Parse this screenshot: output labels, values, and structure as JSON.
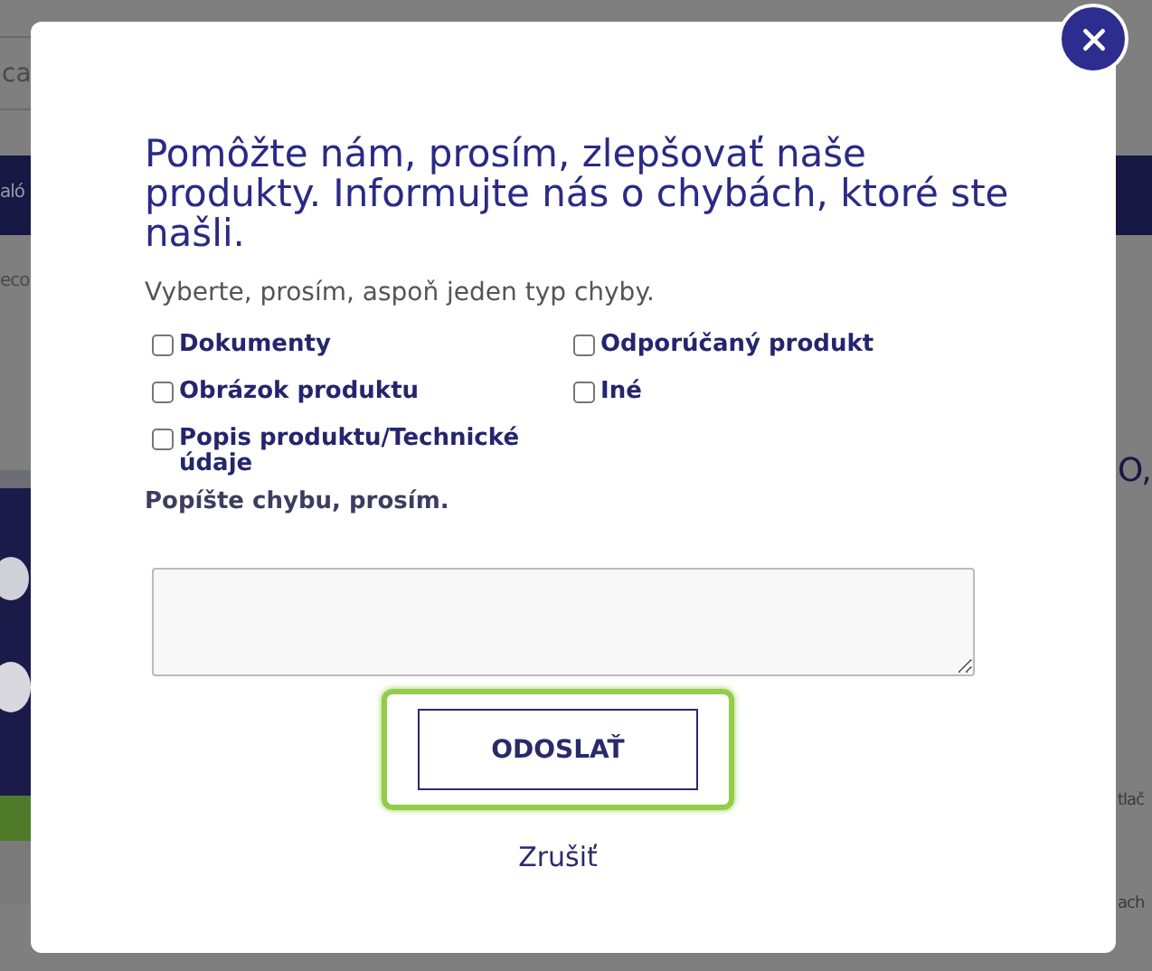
{
  "background": {
    "search_fragment": "ca",
    "nav_fragment": "aló",
    "breadcrumb_fragment": "eco",
    "heading_fragment": "O,",
    "text_fragments": [
      "tlač",
      "ach"
    ]
  },
  "dialog": {
    "title": "Pomôžte nám, prosím, zlepšovať naše produkty. Informujte nás o chybách, ktoré ste našli.",
    "instruction": "Vyberte, prosím, aspoň jeden typ chyby.",
    "options": [
      {
        "label": "Dokumenty",
        "checked": false
      },
      {
        "label": "Odporúčaný produkt",
        "checked": false
      },
      {
        "label": "Obrázok produktu",
        "checked": false
      },
      {
        "label": "Iné",
        "checked": false
      },
      {
        "label": "Popis produktu/Technické údaje",
        "checked": false
      }
    ],
    "description_label": "Popíšte chybu, prosím.",
    "submit": {
      "label": "ODOSLAŤ",
      "focused": true
    },
    "cancel": "Zrušiť"
  }
}
